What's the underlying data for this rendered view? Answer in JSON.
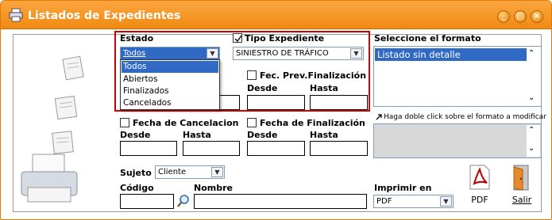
{
  "window": {
    "title": "Listados de Expedientes"
  },
  "estado": {
    "label": "Estado",
    "value": "Todos",
    "options": [
      "Todos",
      "Abiertos",
      "Finalizados",
      "Cancelados"
    ]
  },
  "tipo": {
    "label": "Tipo Expediente",
    "value": "SINIESTRO DE TRÁFICO",
    "checked": true
  },
  "fprev": {
    "label": "Fec. Prev.Finalización",
    "desde": "Desde",
    "hasta": "Hasta"
  },
  "fcancel": {
    "label": "Fecha de Cancelacion",
    "desde": "Desde",
    "hasta": "Hasta"
  },
  "ffin": {
    "label": "Fecha de Finalización",
    "desde": "Desde",
    "hasta": "Hasta"
  },
  "formato": {
    "label": "Seleccione el formato",
    "items": [
      "Listado sin detalle"
    ],
    "hint": "Haga doble click sobre el formato a modificar"
  },
  "sujeto": {
    "label": "Sujeto",
    "value": "Cliente"
  },
  "codigo": {
    "label": "Código"
  },
  "nombre": {
    "label": "Nombre"
  },
  "imprimir": {
    "label": "Imprimir en",
    "value": "PDF"
  },
  "buttons": {
    "pdf": "PDF",
    "salir": "Salir"
  },
  "colors": {
    "accent": "#f0901a",
    "selection": "#316ac5",
    "highlight": "#d00000"
  }
}
